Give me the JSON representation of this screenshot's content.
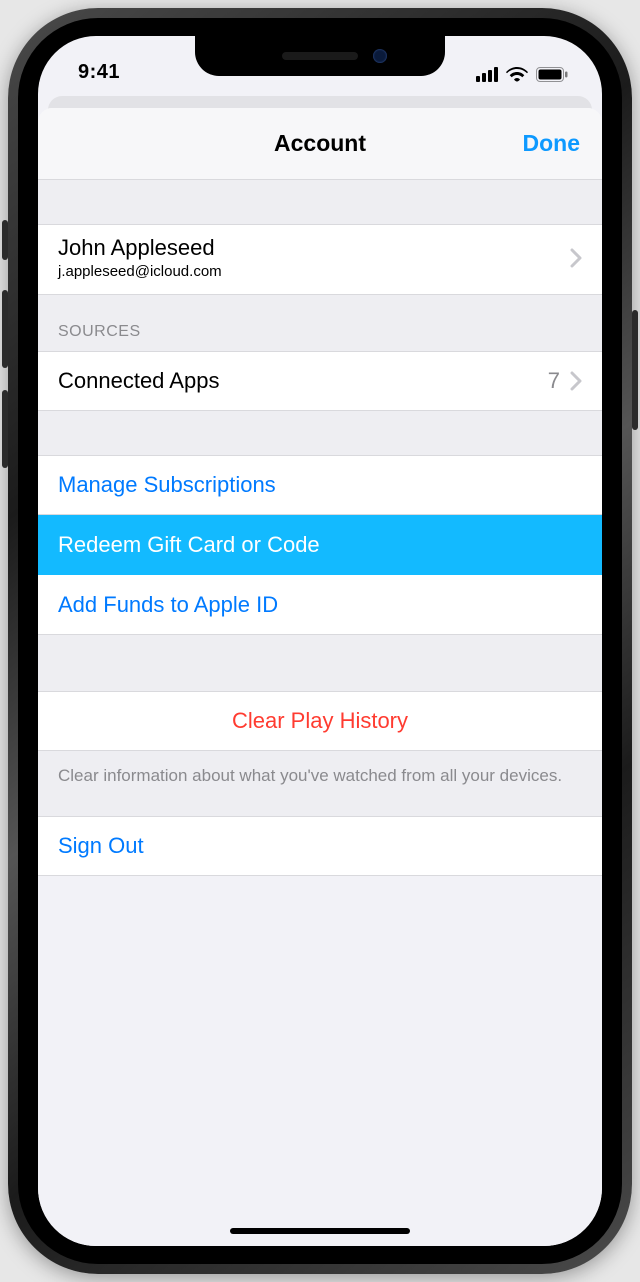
{
  "statusbar": {
    "time": "9:41"
  },
  "navbar": {
    "title": "Account",
    "done": "Done"
  },
  "profile": {
    "name": "John Appleseed",
    "email": "j.appleseed@icloud.com"
  },
  "sources": {
    "header": "SOURCES",
    "connected_apps": {
      "label": "Connected Apps",
      "count": "7"
    }
  },
  "actions": {
    "manage_subscriptions": "Manage Subscriptions",
    "redeem": "Redeem Gift Card or Code",
    "add_funds": "Add Funds to Apple ID"
  },
  "clear": {
    "label": "Clear Play History",
    "footer": "Clear information about what you've watched from all your devices."
  },
  "signout": {
    "label": "Sign Out"
  }
}
